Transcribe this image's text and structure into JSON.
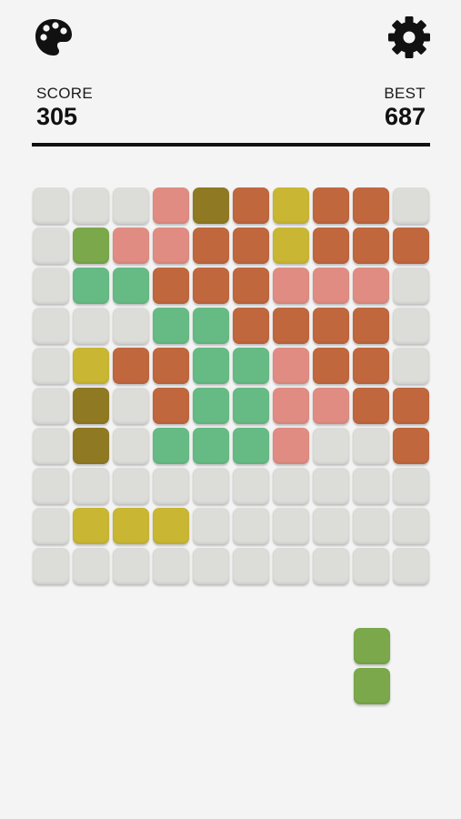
{
  "header": {
    "palette_icon": "palette-icon",
    "settings_icon": "gear-icon"
  },
  "score": {
    "label": "SCORE",
    "value": "305"
  },
  "best": {
    "label": "BEST",
    "value": "687"
  },
  "colors": {
    "E": "#dcdcd9",
    "G": "#7aa84a",
    "P": "#e08c82",
    "O": "#c0673e",
    "D": "#8f7a23",
    "Y": "#c9b633",
    "M": "#66bb84",
    "divider": "#111111",
    "background": "#f4f4f4"
  },
  "board": {
    "rows": 10,
    "cols": 10,
    "cells": [
      [
        "E",
        "E",
        "E",
        "P",
        "D",
        "O",
        "Y",
        "O",
        "O",
        "E"
      ],
      [
        "E",
        "G",
        "P",
        "P",
        "O",
        "O",
        "Y",
        "O",
        "O",
        "O"
      ],
      [
        "E",
        "M",
        "M",
        "O",
        "O",
        "O",
        "P",
        "P",
        "P",
        "E"
      ],
      [
        "E",
        "E",
        "E",
        "M",
        "M",
        "O",
        "O",
        "O",
        "O",
        "E"
      ],
      [
        "E",
        "Y",
        "O",
        "O",
        "M",
        "M",
        "P",
        "O",
        "O",
        "E"
      ],
      [
        "E",
        "D",
        "E",
        "O",
        "M",
        "M",
        "P",
        "P",
        "O",
        "O"
      ],
      [
        "E",
        "D",
        "E",
        "M",
        "M",
        "M",
        "P",
        "E",
        "E",
        "O"
      ],
      [
        "E",
        "E",
        "E",
        "E",
        "E",
        "E",
        "E",
        "E",
        "E",
        "E"
      ],
      [
        "E",
        "Y",
        "Y",
        "Y",
        "E",
        "E",
        "E",
        "E",
        "E",
        "E"
      ],
      [
        "E",
        "E",
        "E",
        "E",
        "E",
        "E",
        "E",
        "E",
        "E",
        "E"
      ]
    ]
  },
  "next_piece": {
    "cells": [
      "G",
      "G"
    ]
  }
}
